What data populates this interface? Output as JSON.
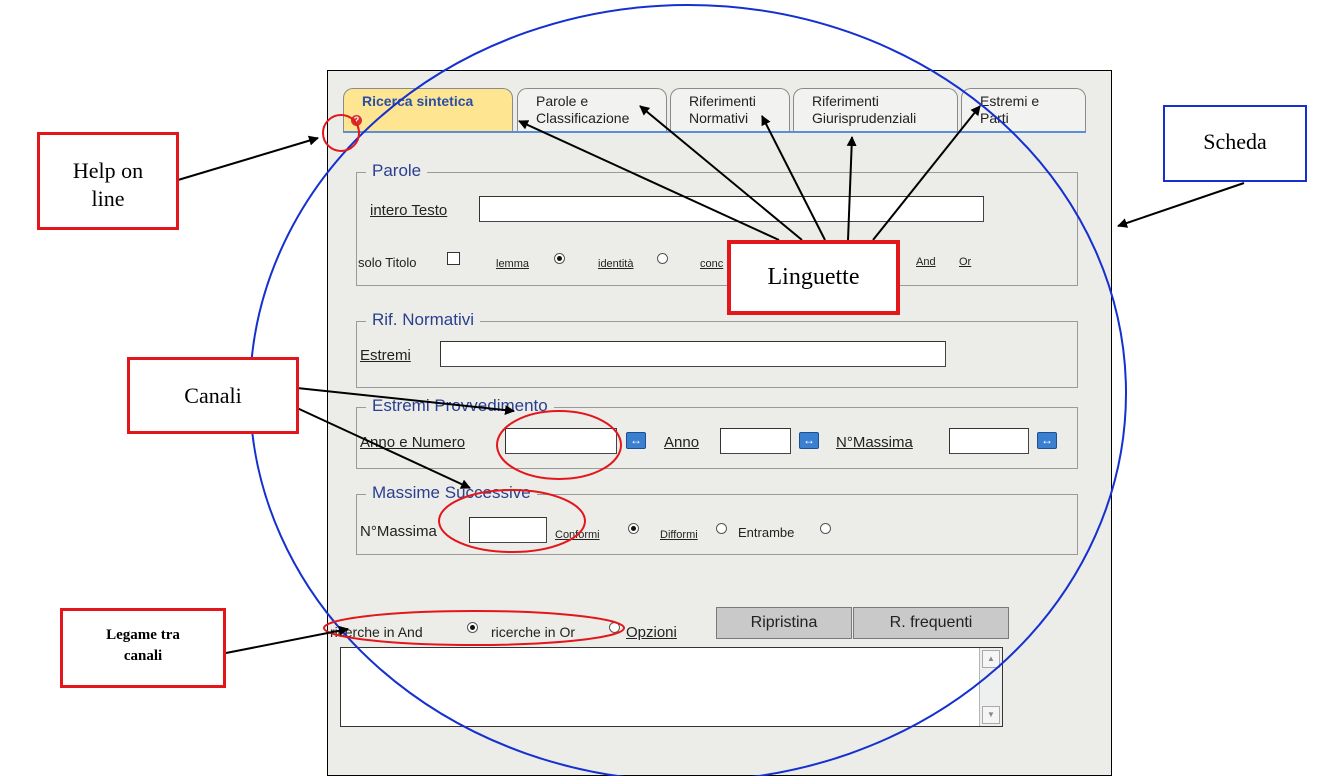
{
  "tabs": [
    {
      "line1": "Ricerca sintetica",
      "line2": ""
    },
    {
      "line1": "Parole e",
      "line2": "Classificazione"
    },
    {
      "line1": "Riferimenti",
      "line2": "Normativi"
    },
    {
      "line1": "Riferimenti",
      "line2": "Giurisprudenziali"
    },
    {
      "line1": "Estremi e",
      "line2": "Parti"
    }
  ],
  "parole": {
    "legend": "Parole",
    "intero_testo": "intero Testo",
    "solo_titolo": "solo Titolo",
    "lemma": "lemma",
    "identita": "identità",
    "conc": "conc",
    "and": "And",
    "or": "Or"
  },
  "rif_normativi": {
    "legend": "Rif. Normativi",
    "estremi": "Estremi"
  },
  "estremi_provvedimento": {
    "legend": "Estremi Provvedimento",
    "anno_numero": "Anno e Numero",
    "anno": "Anno",
    "n_massima": "N°Massima",
    "range_icon": "↔"
  },
  "massime_successive": {
    "legend": "Massime Successive",
    "n_massima": "N°Massima",
    "conformi": "Conformi",
    "difformi": "Difformi",
    "entrambe": "Entrambe"
  },
  "bottom": {
    "ricerche_and": "ricerche in And",
    "ricerche_or": "ricerche in Or",
    "opzioni": "Opzioni",
    "ripristina": "Ripristina",
    "r_frequenti": "R. frequenti",
    "scroll_up": "▲",
    "scroll_down": "▼"
  },
  "callouts": {
    "help_line1": "Help on",
    "help_line2": "line",
    "scheda": "Scheda",
    "linguette": "Linguette",
    "canali": "Canali",
    "legame_line1": "Legame tra",
    "legame_line2": "canali"
  },
  "help_icon": "?",
  "colors": {
    "annotation_red": "#e3161c",
    "annotation_blue": "#1530d0",
    "active_tab": "#fde592"
  }
}
